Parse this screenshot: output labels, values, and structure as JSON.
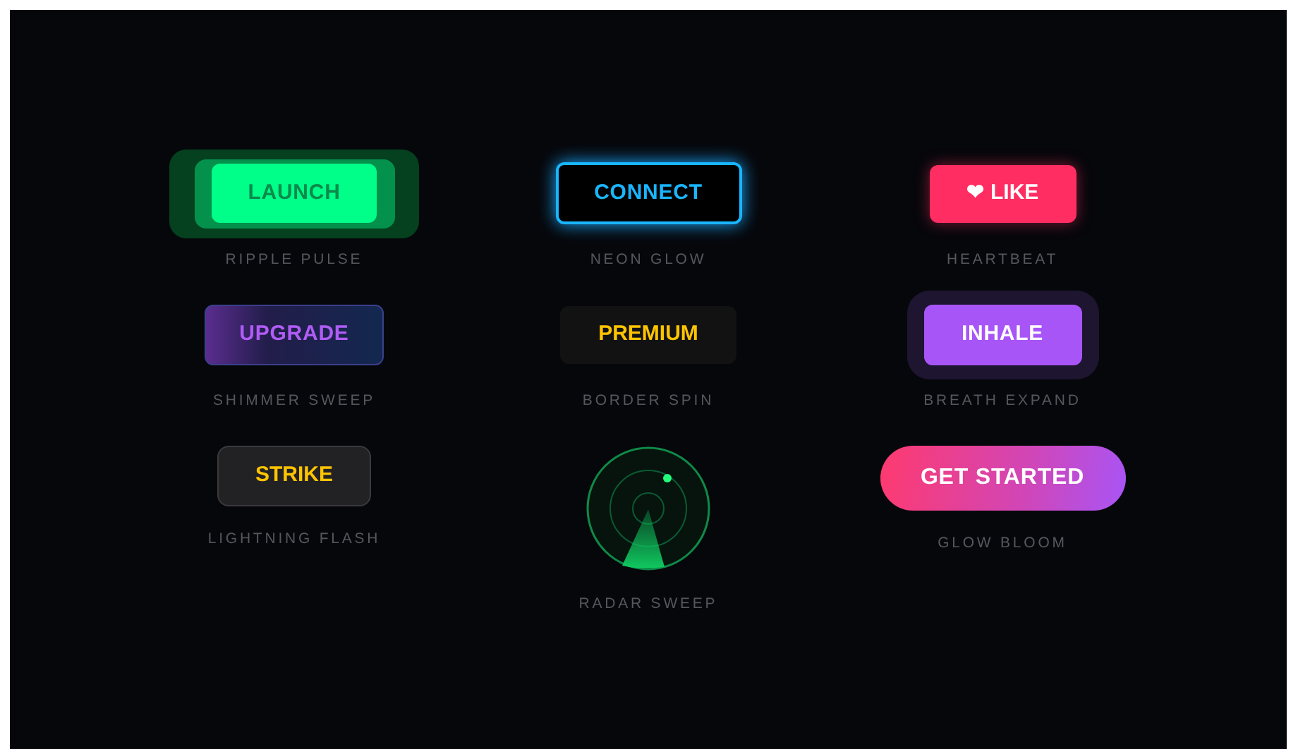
{
  "rows": [
    {
      "items": [
        {
          "kind": "ripple",
          "button": "LAUNCH",
          "label": "RIPPLE PULSE"
        },
        {
          "kind": "neon",
          "button": "CONNECT",
          "label": "NEON GLOW"
        },
        {
          "kind": "heartbeat",
          "button": "❤ LIKE",
          "label": "HEARTBEAT"
        }
      ]
    },
    {
      "items": [
        {
          "kind": "shimmer",
          "button": "UPGRADE",
          "label": "SHIMMER SWEEP"
        },
        {
          "kind": "border-spin",
          "button": "PREMIUM",
          "label": "BORDER SPIN"
        },
        {
          "kind": "breath",
          "button": "INHALE",
          "label": "BREATH EXPAND"
        }
      ]
    },
    {
      "items": [
        {
          "kind": "lightning",
          "button": "STRIKE",
          "label": "LIGHTNING FLASH"
        },
        {
          "kind": "radar",
          "label": "RADAR SWEEP"
        },
        {
          "kind": "glow-bloom",
          "button": "GET STARTED",
          "label": "GLOW BLOOM"
        }
      ]
    }
  ]
}
